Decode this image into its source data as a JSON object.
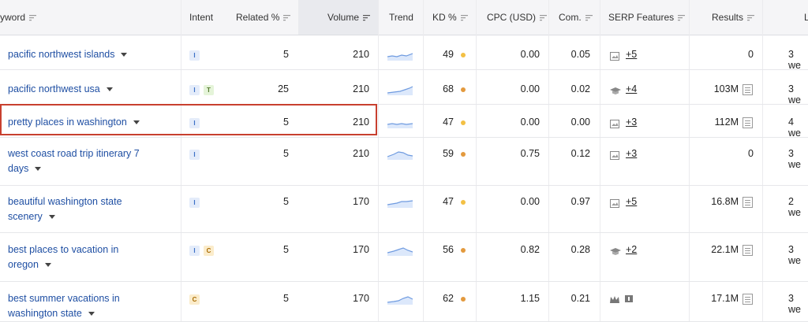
{
  "headers": {
    "keyword": "yword",
    "intent": "Intent",
    "related": "Related %",
    "volume": "Volume",
    "trend": "Trend",
    "kd": "KD %",
    "cpc": "CPC (USD)",
    "com": "Com.",
    "serp": "SERP Features",
    "results": "Results",
    "last": "L"
  },
  "colors": {
    "kd_yellow": "#f3c044",
    "kd_orange": "#e39a3e",
    "link": "#1f4fa3",
    "highlight": "#c8402f"
  },
  "rows": [
    {
      "keyword": "pacific northwest islands",
      "keyword_line2": "",
      "intents": [
        "I"
      ],
      "related": "5",
      "volume": "210",
      "kd": "49",
      "kd_color": "#f3c044",
      "cpc": "0.00",
      "com": "0.05",
      "serp_icon": "image-icon",
      "serp_more": "+5",
      "results": "0",
      "results_doc": false,
      "last": "3 we"
    },
    {
      "keyword": "pacific northwest usa",
      "keyword_line2": "",
      "intents": [
        "I",
        "T"
      ],
      "related": "25",
      "volume": "210",
      "kd": "68",
      "kd_color": "#e39a3e",
      "cpc": "0.00",
      "com": "0.02",
      "serp_icon": "graduation-cap-icon",
      "serp_more": "+4",
      "results": "103M",
      "results_doc": true,
      "last": "3 we"
    },
    {
      "keyword": "pretty places in washington",
      "keyword_line2": "",
      "intents": [
        "I"
      ],
      "related": "5",
      "volume": "210",
      "kd": "47",
      "kd_color": "#f3c044",
      "cpc": "0.00",
      "com": "0.00",
      "serp_icon": "image-icon",
      "serp_more": "+3",
      "results": "112M",
      "results_doc": true,
      "last": "4 we"
    },
    {
      "keyword": "west coast road trip itinerary 7",
      "keyword_line2": "days",
      "intents": [
        "I"
      ],
      "related": "5",
      "volume": "210",
      "kd": "59",
      "kd_color": "#e39a3e",
      "cpc": "0.75",
      "com": "0.12",
      "serp_icon": "image-icon",
      "serp_more": "+3",
      "results": "0",
      "results_doc": false,
      "last": "3 we"
    },
    {
      "keyword": "beautiful washington state",
      "keyword_line2": "scenery",
      "intents": [
        "I"
      ],
      "related": "5",
      "volume": "170",
      "kd": "47",
      "kd_color": "#f3c044",
      "cpc": "0.00",
      "com": "0.97",
      "serp_icon": "image-icon",
      "serp_more": "+5",
      "results": "16.8M",
      "results_doc": true,
      "last": "2 we"
    },
    {
      "keyword": "best places to vacation in",
      "keyword_line2": "oregon",
      "intents": [
        "I",
        "C"
      ],
      "related": "5",
      "volume": "170",
      "kd": "56",
      "kd_color": "#e39a3e",
      "cpc": "0.82",
      "com": "0.28",
      "serp_icon": "graduation-cap-icon",
      "serp_more": "+2",
      "results": "22.1M",
      "results_doc": true,
      "last": "3 we"
    },
    {
      "keyword": "best summer vacations in",
      "keyword_line2": "washington state",
      "intents": [
        "C"
      ],
      "related": "5",
      "volume": "170",
      "kd": "62",
      "kd_color": "#e39a3e",
      "cpc": "1.15",
      "com": "0.21",
      "serp_icon": "crown-icon",
      "serp_more": "",
      "results": "17.1M",
      "results_doc": true,
      "last": "3 we"
    }
  ]
}
